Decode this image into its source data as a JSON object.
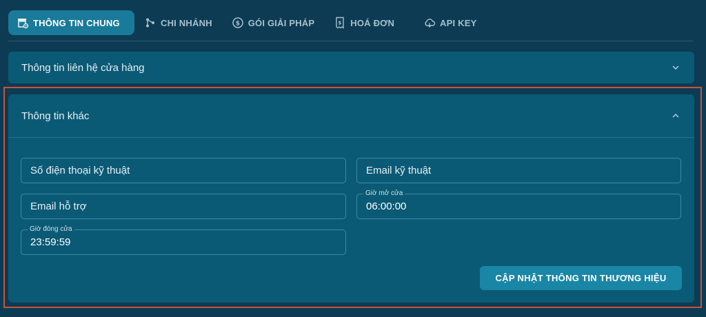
{
  "tabs": [
    {
      "label": "THÔNG TIN CHUNG",
      "icon": "store-settings-icon",
      "active": true
    },
    {
      "label": "CHI NHÁNH",
      "icon": "branch-icon",
      "active": false
    },
    {
      "label": "GÓI GIẢI PHÁP",
      "icon": "dollar-cycle-icon",
      "active": false
    },
    {
      "label": "HOÁ ĐƠN",
      "icon": "receipt-icon",
      "active": false
    },
    {
      "label": "API KEY",
      "icon": "cloud-icon",
      "active": false
    }
  ],
  "contact_section": {
    "title": "Thông tin liên hệ cửa hàng",
    "expanded": false
  },
  "other_section": {
    "title": "Thông tin khác",
    "expanded": true,
    "fields": {
      "tech_phone": {
        "placeholder": "Số điện thoại kỹ thuật"
      },
      "tech_email": {
        "placeholder": "Email kỹ thuật"
      },
      "support_email": {
        "placeholder": "Email hỗ trợ"
      },
      "open_time": {
        "label": "Giờ mở cửa",
        "value": "06:00:00"
      },
      "close_time": {
        "label": "Giờ đóng cửa",
        "value": "23:59:59"
      }
    },
    "submit_label": "CẬP NHẬT THÔNG TIN THƯƠNG HIỆU"
  },
  "colors": {
    "background": "#0d3b54",
    "panel": "#0b5a75",
    "active_tab": "#1a7a99",
    "button": "#1a86a6",
    "highlight_border": "#c9533a"
  }
}
